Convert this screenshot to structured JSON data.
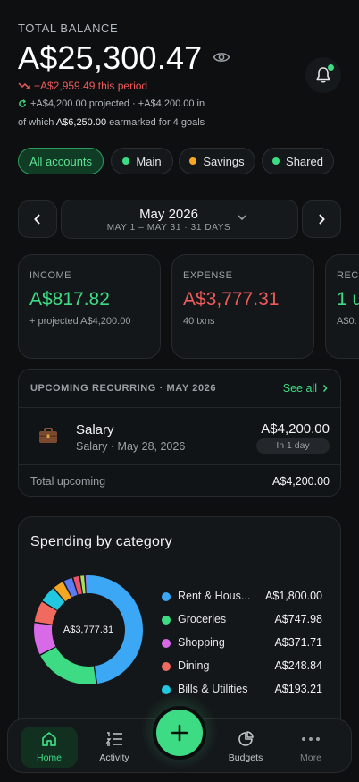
{
  "header": {
    "total_label": "TOTAL BALANCE",
    "balance": "A$25,300.47",
    "period_change": "−A$2,959.49 this period",
    "projected_line": "+A$4,200.00 projected · +A$4,200.00 in",
    "goal_prefix": "of which",
    "goal_amount": "A$6,250.00",
    "goal_suffix": "earmarked for 4 goals"
  },
  "accounts": [
    {
      "label": "All accounts",
      "color": ""
    },
    {
      "label": "Main",
      "color": "#3ddc84"
    },
    {
      "label": "Savings",
      "color": "#f5a623"
    },
    {
      "label": "Shared",
      "color": "#3ddc84"
    }
  ],
  "period": {
    "title": "May 2026",
    "range": "MAY 1 – MAY 31 · 31 DAYS"
  },
  "stats": [
    {
      "label": "INCOME",
      "value": "A$817.82",
      "sub": "+ projected A$4,200.00",
      "color": "#3ddc84"
    },
    {
      "label": "EXPENSE",
      "value": "A$3,777.31",
      "sub": "40 txns",
      "color": "#ef5b5b"
    },
    {
      "label": "RECU",
      "value": "1 u",
      "sub": "A$0.",
      "color": "#3ddc84"
    }
  ],
  "recurring": {
    "heading": "UPCOMING RECURRING · MAY 2026",
    "see_all": "See all",
    "item": {
      "name": "Salary",
      "sub": "Salary · May 28, 2026",
      "amount": "A$4,200.00",
      "badge": "In 1 day"
    },
    "total_label": "Total upcoming",
    "total_value": "A$4,200.00"
  },
  "spending": {
    "title": "Spending by category",
    "center_label": "A$3,777.31",
    "legend": [
      {
        "name": "Rent & Hous...",
        "value": "A$1,800.00",
        "color": "#3ba7f5"
      },
      {
        "name": "Groceries",
        "value": "A$747.98",
        "color": "#3ddc84"
      },
      {
        "name": "Shopping",
        "value": "A$371.71",
        "color": "#d86ae8"
      },
      {
        "name": "Dining",
        "value": "A$248.84",
        "color": "#f06a5f"
      },
      {
        "name": "Bills & Utilities",
        "value": "A$193.21",
        "color": "#22c8e0"
      }
    ]
  },
  "chart_data": {
    "type": "pie",
    "categories": [
      "Rent & Hous...",
      "Groceries",
      "Shopping",
      "Dining",
      "Bills & Utilities",
      "",
      "",
      "",
      "",
      ""
    ],
    "values": [
      1800.0,
      747.98,
      371.71,
      248.84,
      193.21,
      130,
      110,
      80,
      55,
      39.57
    ],
    "colors": [
      "#3ba7f5",
      "#3ddc84",
      "#d86ae8",
      "#f06a5f",
      "#22c8e0",
      "#f5a623",
      "#5b7cf5",
      "#e9536f",
      "#a4e05a",
      "#8f7cf0"
    ],
    "title": "Spending by category",
    "center": "A$3,777.31"
  },
  "nav": {
    "home": "Home",
    "activity": "Activity",
    "budgets": "Budgets",
    "more": "More"
  }
}
